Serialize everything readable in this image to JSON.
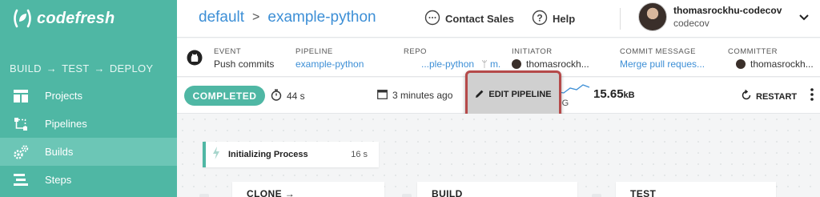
{
  "sidebar": {
    "logo_text_bold": "codefresh",
    "flow": [
      "BUILD",
      "TEST",
      "DEPLOY"
    ],
    "items": [
      {
        "label": "Projects",
        "icon": "projects-icon"
      },
      {
        "label": "Pipelines",
        "icon": "pipelines-icon"
      },
      {
        "label": "Builds",
        "icon": "builds-icon"
      },
      {
        "label": "Steps",
        "icon": "steps-icon"
      }
    ],
    "active_index": 2
  },
  "header": {
    "project": "default",
    "separator": ">",
    "pipeline": "example-python",
    "contact_sales": "Contact Sales",
    "help": "Help",
    "user_name": "thomasrockhu-codecov",
    "user_org": "codecov"
  },
  "info": {
    "event_label": "EVENT",
    "event_value": "Push commits",
    "pipeline_label": "PIPELINE",
    "pipeline_value": "example-python",
    "repo_label": "REPO",
    "repo_value": "...ple-python",
    "repo_branch": "m.",
    "initiator_label": "INITIATOR",
    "initiator_value": "thomasrockh...",
    "commit_message_label": "COMMIT MESSAGE",
    "commit_message_value": "Merge pull reques...",
    "committer_label": "COMMITTER",
    "committer_value": "thomasrockh..."
  },
  "status": {
    "badge": "COMPLETED",
    "duration": "44 s",
    "started": "3 minutes ago",
    "size_class": "Small",
    "log_label": "LOG",
    "log_size_value": "15.65",
    "log_size_unit": "kB",
    "edit_pipeline": "EDIT PIPELINE",
    "restart": "RESTART"
  },
  "canvas": {
    "init_step": {
      "name": "Initializing Process",
      "time": "16 s"
    },
    "stages": [
      "CLONE →",
      "BUILD",
      "TEST"
    ]
  },
  "colors": {
    "brand": "#4fb7a4",
    "link": "#3d8fd6",
    "highlight_border": "#b54a4a"
  }
}
